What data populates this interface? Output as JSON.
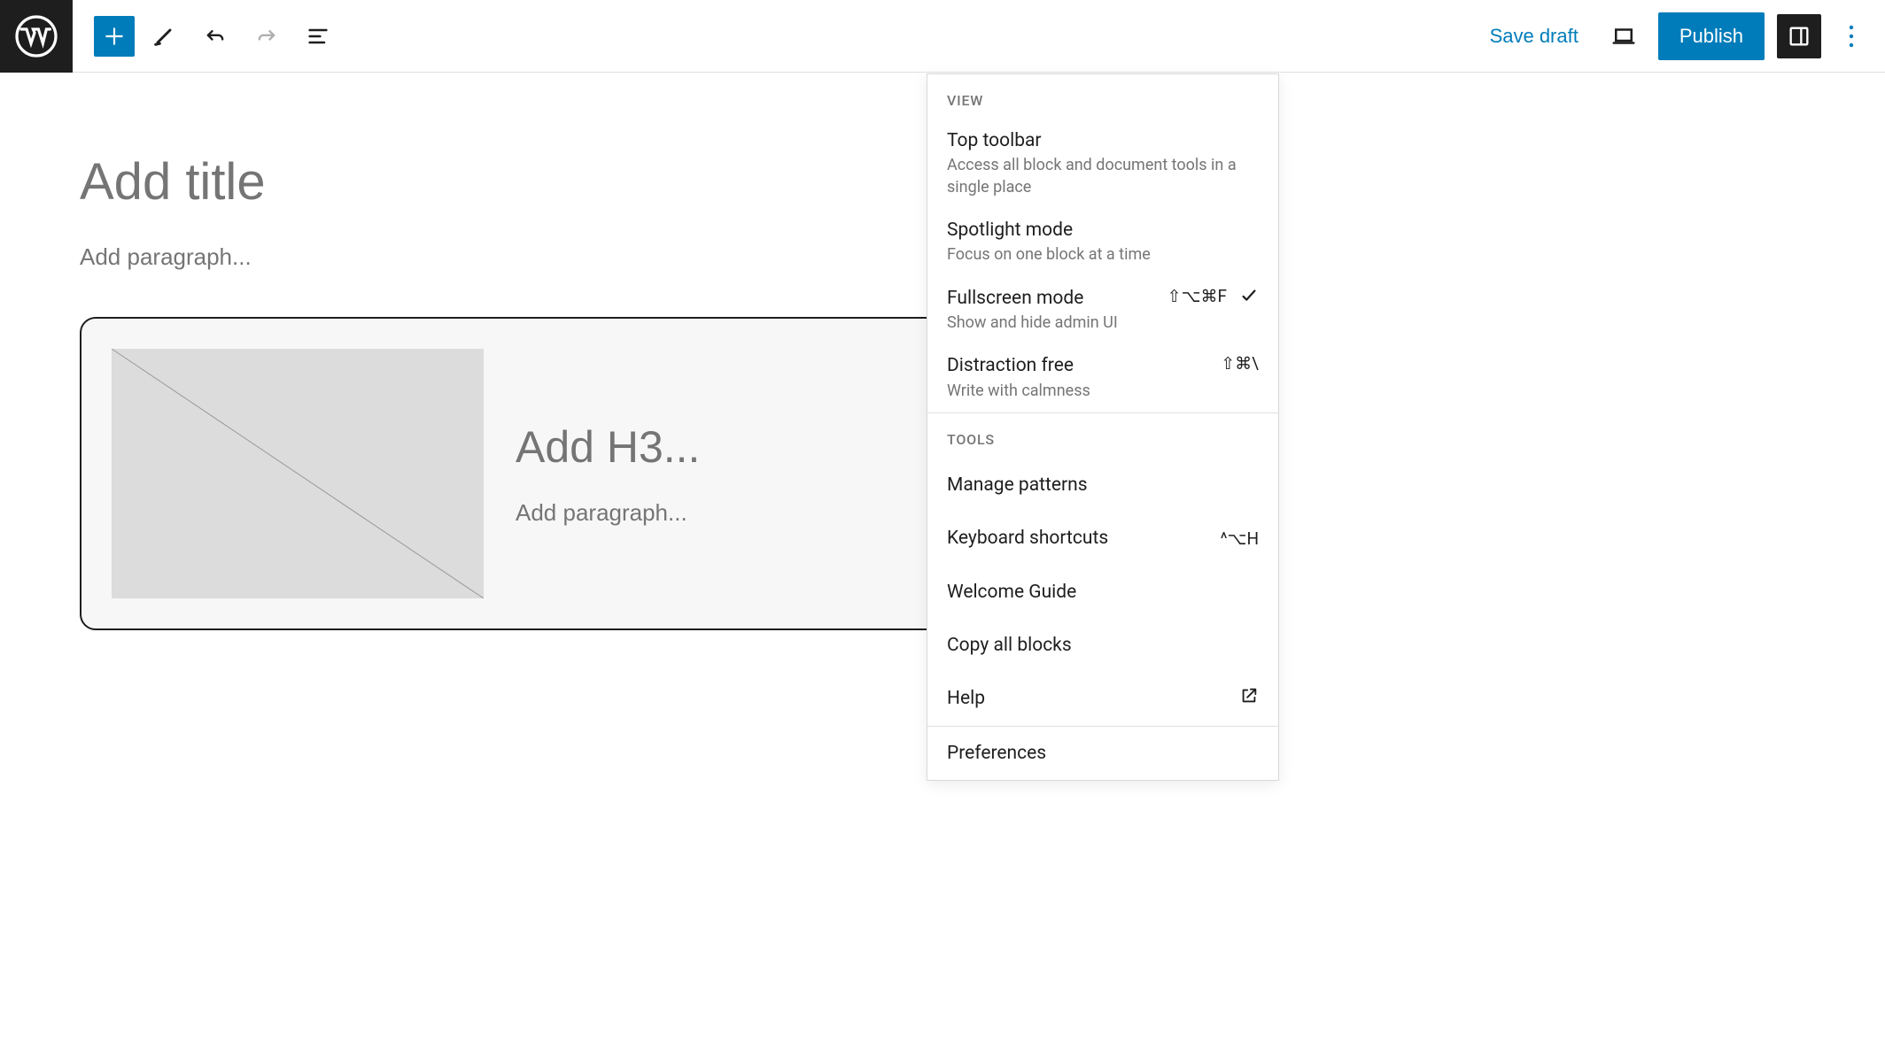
{
  "toolbar": {
    "save_draft_label": "Save draft",
    "publish_label": "Publish"
  },
  "editor": {
    "title_placeholder": "Add title",
    "paragraph_placeholder": "Add paragraph...",
    "media_h3_placeholder": "Add H3...",
    "media_paragraph_placeholder": "Add paragraph..."
  },
  "dropdown": {
    "view_section": "VIEW",
    "tools_section": "TOOLS",
    "items_view": [
      {
        "label": "Top toolbar",
        "desc": "Access all block and document tools in a single place",
        "shortcut": "",
        "checked": false
      },
      {
        "label": "Spotlight mode",
        "desc": "Focus on one block at a time",
        "shortcut": "",
        "checked": false
      },
      {
        "label": "Fullscreen mode",
        "desc": "Show and hide admin UI",
        "shortcut": "⇧⌥⌘F",
        "checked": true
      },
      {
        "label": "Distraction free",
        "desc": "Write with calmness",
        "shortcut": "⇧⌘\\",
        "checked": false
      }
    ],
    "items_tools": [
      {
        "label": "Manage patterns",
        "shortcut": "",
        "external": false
      },
      {
        "label": "Keyboard shortcuts",
        "shortcut": "^⌥H",
        "external": false
      },
      {
        "label": "Welcome Guide",
        "shortcut": "",
        "external": false
      },
      {
        "label": "Copy all blocks",
        "shortcut": "",
        "external": false
      },
      {
        "label": "Help",
        "shortcut": "",
        "external": true
      }
    ],
    "preferences_label": "Preferences"
  }
}
